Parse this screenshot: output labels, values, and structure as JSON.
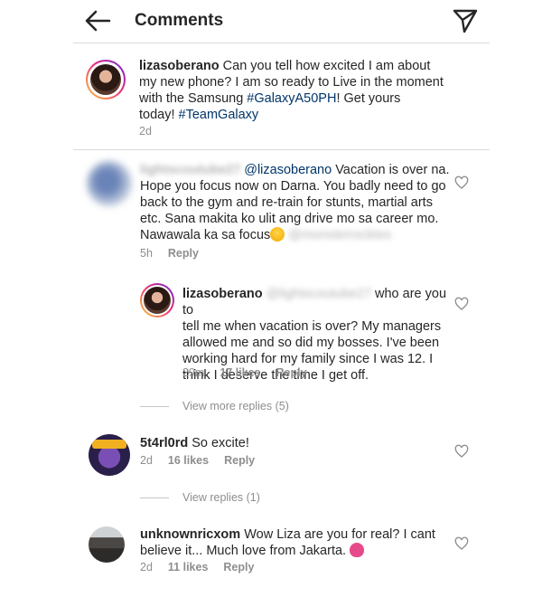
{
  "header": {
    "title": "Comments",
    "back_icon": "arrow-left-icon",
    "send_icon": "paper-plane-icon"
  },
  "caption": {
    "username": "lizasoberano",
    "text_1": "Can you tell how excited I am about",
    "text_2": "my new phone? I am so ready to Live in the moment",
    "text_3a": "with the Samsung ",
    "hashtag_1": "#GalaxyA50PH",
    "text_3b": "! Get yours",
    "text_4a": "today! ",
    "hashtag_2": "#TeamGalaxy",
    "time": "2d"
  },
  "comments": [
    {
      "username_blurred": "lightscoutube27",
      "mention": "@lizasoberano",
      "line_1": " Vacation is over na.",
      "line_2": "Hope you focus now on Darna. You badly need to go",
      "line_3": "back to the gym and re-train for stunts, martial arts",
      "line_4": "etc. Sana makita ko ulit ang drive mo sa career mo.",
      "line_5": "Nawawala ka sa focus",
      "mention_blurred": "@monsterrocktes",
      "time": "5h",
      "reply_label": "Reply"
    },
    {
      "username": "lizasoberano",
      "mention_blurred": "@lightscoutube27",
      "line_1": " who are you to",
      "line_2": "tell me when vacation is over? My managers",
      "line_3": "allowed me and so did my bosses. I've been",
      "line_4": "working hard for my family since I was 12. I",
      "line_5": "think I deserve the time I get off.",
      "time": "29m",
      "likes": "17 likes",
      "reply_label": "Reply"
    },
    {
      "view_more": "View more replies (5)"
    },
    {
      "username": "5t4rl0rd",
      "text": " So excite!",
      "time": "2d",
      "likes": "16 likes",
      "reply_label": "Reply",
      "view_replies": "View replies (1)"
    },
    {
      "username": "unknownricxom",
      "line_1": " Wow Liza are you for real? I cant",
      "line_2": "believe it... Much love from Jakarta. ",
      "time": "2d",
      "likes": "11 likes",
      "reply_label": "Reply"
    }
  ],
  "colors": {
    "link": "#003569",
    "meta": "#8e8e8e",
    "text": "#262626",
    "divider": "#dbdbdb"
  }
}
